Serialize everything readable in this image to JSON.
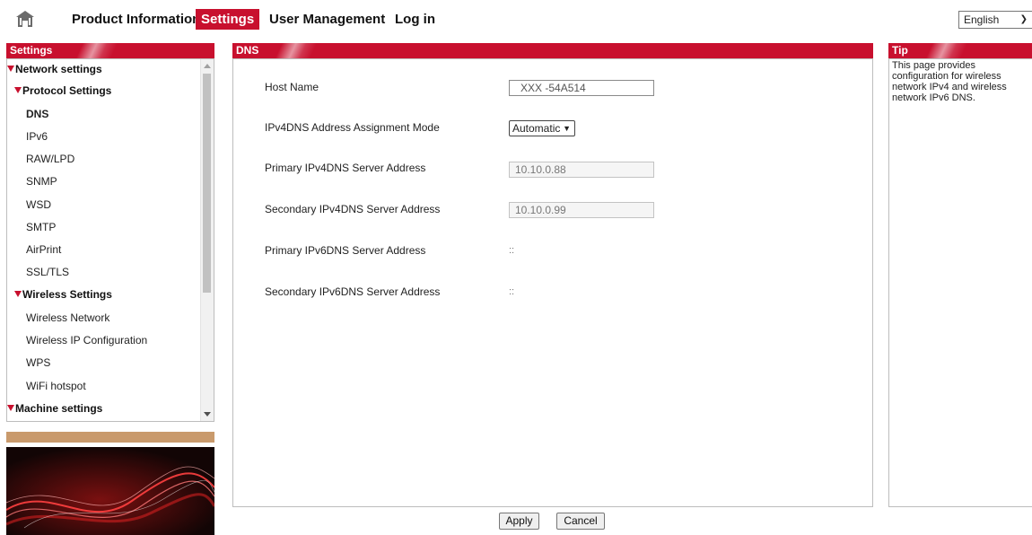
{
  "nav": {
    "tabs": [
      {
        "label": "Product Information",
        "active": false
      },
      {
        "label": "Settings",
        "active": true
      },
      {
        "label": "User Management",
        "active": false
      },
      {
        "label": "Log in",
        "active": false
      }
    ],
    "language": "English"
  },
  "colors": {
    "accent": "#c8102e",
    "tan": "#c99a6c"
  },
  "icons": {
    "home": "home-icon",
    "expand": "triangle-down-icon"
  },
  "sidebar": {
    "title": "Settings",
    "items": [
      {
        "label": "Network settings",
        "level": 0,
        "group": true
      },
      {
        "label": "Protocol Settings",
        "level": 1,
        "group": true
      },
      {
        "label": "DNS",
        "level": 2,
        "selected": true
      },
      {
        "label": "IPv6",
        "level": 2
      },
      {
        "label": "RAW/LPD",
        "level": 2
      },
      {
        "label": "SNMP",
        "level": 2
      },
      {
        "label": "WSD",
        "level": 2
      },
      {
        "label": "SMTP",
        "level": 2
      },
      {
        "label": "AirPrint",
        "level": 2
      },
      {
        "label": "SSL/TLS",
        "level": 2
      },
      {
        "label": "Wireless Settings",
        "level": 1,
        "group": true
      },
      {
        "label": "Wireless Network",
        "level": 2
      },
      {
        "label": "Wireless IP Configuration",
        "level": 2
      },
      {
        "label": "WPS",
        "level": 2
      },
      {
        "label": "WiFi hotspot",
        "level": 2
      },
      {
        "label": "Machine settings",
        "level": 0,
        "group": true
      }
    ]
  },
  "main": {
    "title": "DNS",
    "host_name": {
      "label": "Host Name",
      "value": "XXX  -54A514"
    },
    "ipv4_mode": {
      "label": "IPv4DNS Address Assignment Mode",
      "value": "Automatic"
    },
    "primary_ipv4": {
      "label": "Primary IPv4DNS Server Address",
      "value": "10.10.0.88"
    },
    "secondary_ipv4": {
      "label": "Secondary IPv4DNS Server Address",
      "value": "10.10.0.99"
    },
    "primary_ipv6": {
      "label": "Primary IPv6DNS Server Address",
      "value": "::"
    },
    "secondary_ipv6": {
      "label": "Secondary IPv6DNS Server Address",
      "value": "::"
    }
  },
  "buttons": {
    "apply": "Apply",
    "cancel": "Cancel"
  },
  "tip": {
    "title": "Tip",
    "text": "This page provides configuration for wireless network IPv4 and wireless network IPv6 DNS."
  }
}
